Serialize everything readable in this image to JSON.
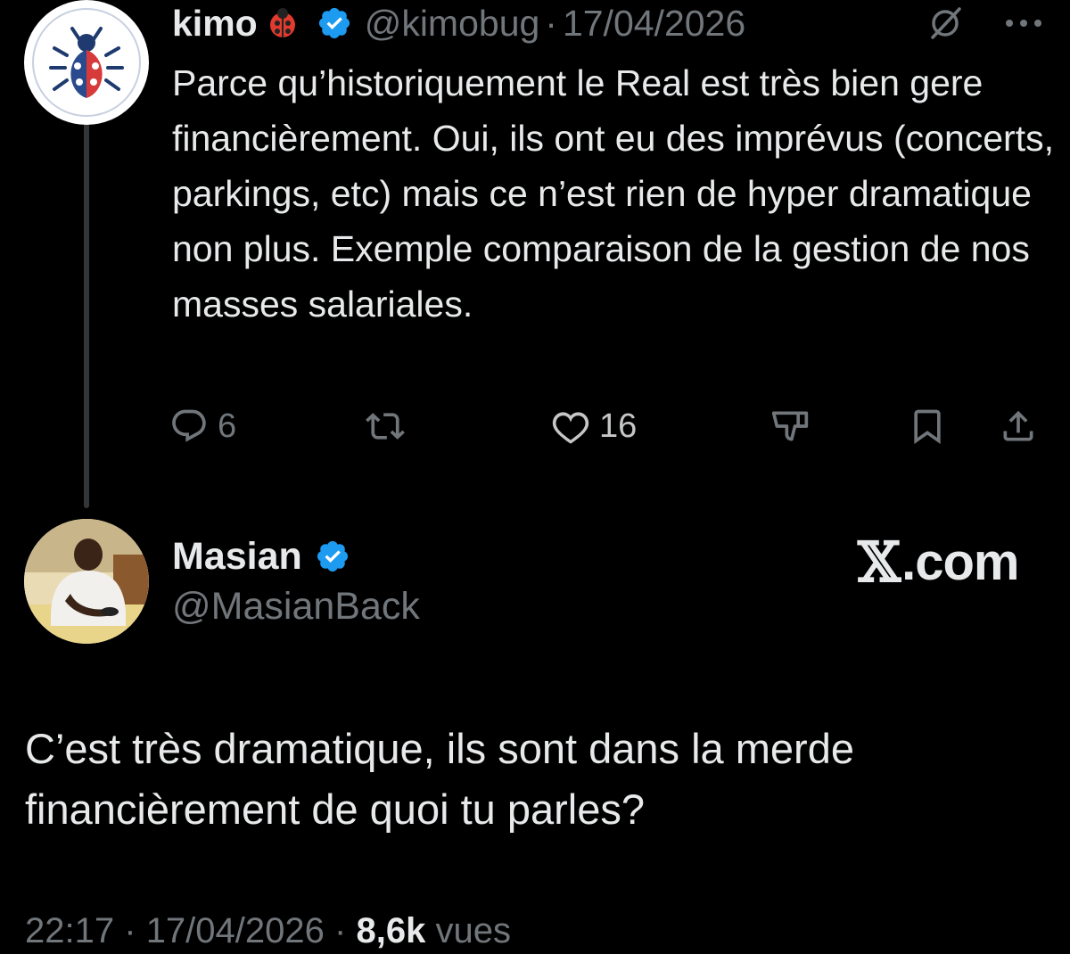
{
  "parent_tweet": {
    "name": "kimo",
    "emoji": "ladybug",
    "handle": "@kimobug",
    "separator": "·",
    "date": "17/04/2026",
    "text": "Parce qu’historiquement le Real est très bien gere financièrement. Oui, ils ont eu des imprévus (concerts, parkings, etc) mais ce n’est rien de hyper dramatique non plus. Exemple comparaison de la gestion de nos masses salariales.",
    "stats": {
      "replies": "6",
      "likes": "16"
    },
    "icons": [
      "reply-icon",
      "repost-icon",
      "like-icon",
      "dislike-icon",
      "bookmark-icon",
      "share-icon",
      "grok-icon",
      "more-icon"
    ]
  },
  "main_tweet": {
    "name": "Masian",
    "handle": "@MasianBack",
    "brand": {
      "mark": "𝕏",
      "suffix": ".com"
    },
    "text": "C’est très dramatique, ils sont dans la merde financièrement de quoi tu parles?",
    "time": "22:17",
    "separator": "·",
    "date": "17/04/2026",
    "views": "8,6k",
    "views_label": "vues"
  },
  "colors": {
    "background": "#000000",
    "text": "#e7e9ea",
    "muted": "#71767b",
    "verified": "#1d9bf0"
  }
}
